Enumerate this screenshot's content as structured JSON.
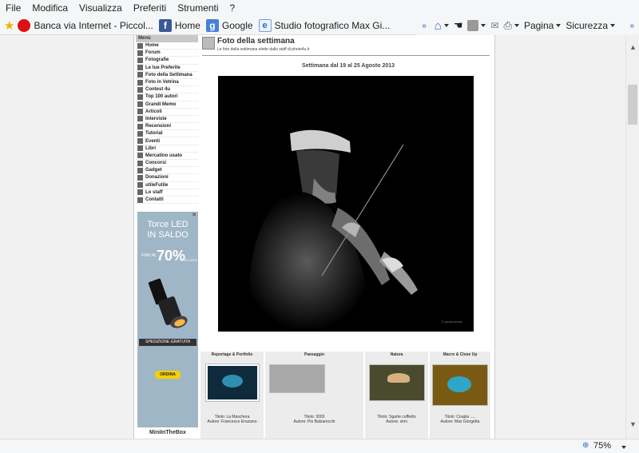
{
  "menubar": {
    "items": [
      "File",
      "Modifica",
      "Visualizza",
      "Preferiti",
      "Strumenti",
      "?"
    ]
  },
  "favorites": {
    "items": [
      {
        "label": "Banca via Internet - Piccol...",
        "icon": "bank-icon"
      },
      {
        "label": "Home",
        "icon": "facebook-icon"
      },
      {
        "label": "Google",
        "icon": "google-icon"
      },
      {
        "label": "Studio fotografico Max Gi...",
        "icon": "ie-page-icon"
      }
    ]
  },
  "commandbar": {
    "page_label": "Pagina",
    "security_label": "Sicurezza"
  },
  "statusbar": {
    "zoom": "75%"
  },
  "sidebar": {
    "title": "Menù",
    "items": [
      "Home",
      "Forum",
      "Fotografie",
      "Le tue Preferite",
      "Foto della Settimana",
      "Foto in Vetrina",
      "Contest 4u",
      "Top 100 autori",
      "Grandi Memo",
      "Articoli",
      "Interviste",
      "Recensioni",
      "Tutorial",
      "Eventi",
      "Libri",
      "Mercatino usato",
      "Concorsi",
      "Gadget",
      "Donazioni",
      "utileFutile",
      "Lo staff",
      "Contatti"
    ],
    "ad": {
      "line1": "Torce LED",
      "line2": "IN SALDO",
      "fino": "FINO AL",
      "percent": "70%",
      "sconto": "DI SCONTO",
      "shipping": "SPEDIZIONE GRATUITA",
      "order": "ORDINA",
      "brand": "MiniInTheBox",
      "close": "✕"
    }
  },
  "content": {
    "title": "Foto della settimana",
    "subtitle": "Le foto della settimana elette dallo staff di photo4u.it",
    "week": "Settimana dal 19 al 25 Agosto 2013",
    "watermark": "© paoldrowsek",
    "categories": [
      {
        "name": "Reportage & Portfolio",
        "title": "Titolo: La Maschera",
        "author": "Autore: Francesco Eroziano"
      },
      {
        "name": "Paesaggio",
        "title": "Titolo: 3003",
        "author": "Autore: Pio Balzarocchi"
      },
      {
        "name": "Natura",
        "title": "Titolo: Sgarte cuffietto",
        "author": "Autore: simi"
      },
      {
        "name": "Macro & Close Up",
        "title": "Titolo: Coupla .....",
        "author": "Autore: Max Giorgetta"
      }
    ]
  }
}
